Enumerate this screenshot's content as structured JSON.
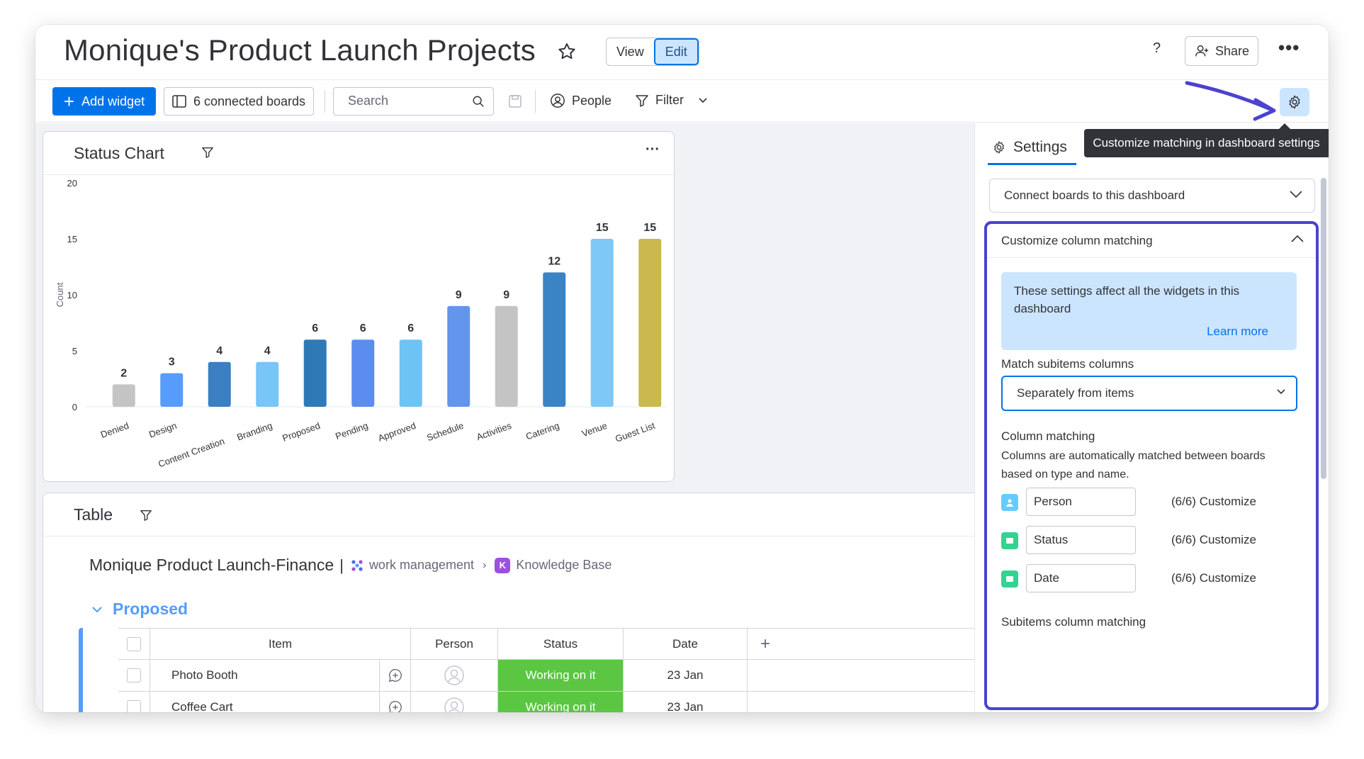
{
  "header": {
    "title": "Monique's Product Launch Projects",
    "view_label": "View",
    "edit_label": "Edit",
    "help_label": "?",
    "share_label": "Share"
  },
  "toolbar": {
    "add_widget_label": "Add widget",
    "boards_label": "6 connected boards",
    "search_placeholder": "Search",
    "people_label": "People",
    "filter_label": "Filter",
    "tooltip": "Customize matching in dashboard settings"
  },
  "chart_widget": {
    "title": "Status Chart"
  },
  "chart_data": {
    "type": "bar",
    "title": "Status Chart",
    "xlabel": "",
    "ylabel": "Count",
    "ylim": [
      0,
      20
    ],
    "yticks": [
      0,
      5,
      10,
      15,
      20
    ],
    "grid": false,
    "categories": [
      "Denied",
      "Design",
      "Content Creation",
      "Branding",
      "Proposed",
      "Pending",
      "Approved",
      "Schedule",
      "Activities",
      "Catering",
      "Venue",
      "Guest List"
    ],
    "values": [
      2,
      3,
      4,
      4,
      6,
      6,
      6,
      9,
      9,
      12,
      15,
      15
    ],
    "colors": [
      "#c4c4c4",
      "#579bfc",
      "#3a7fc1",
      "#78c5f7",
      "#2f79b7",
      "#5b8def",
      "#6ec3f5",
      "#6495ed",
      "#c4c4c4",
      "#3a84c5",
      "#7ec8f7",
      "#c9b94e"
    ]
  },
  "table_widget": {
    "title": "Table",
    "board_name": "Monique Product Launch-Finance",
    "pipe": "|",
    "workspace": "work management",
    "crumb_sep": "›",
    "kb_letter": "K",
    "kb_name": "Knowledge Base",
    "group_name": "Proposed",
    "columns": {
      "item": "Item",
      "person": "Person",
      "status": "Status",
      "date": "Date",
      "add": "+"
    },
    "rows": [
      {
        "item": "Photo Booth",
        "status": "Working on it",
        "date": "23 Jan"
      },
      {
        "item": "Coffee Cart",
        "status": "Working on it",
        "date": "23 Jan"
      }
    ]
  },
  "settings": {
    "tab_label": "Settings",
    "connect_label": "Connect boards to this dashboard",
    "matching_label": "Customize column matching",
    "info_text": "These settings affect all the widgets in this dashboard",
    "learn_more": "Learn more",
    "subitems_label": "Match subitems columns",
    "subitems_value": "Separately from items",
    "column_matching_label": "Column matching",
    "column_matching_desc": "Columns are automatically matched between boards based on type and name.",
    "matches": [
      {
        "name": "Person",
        "count": "(6/6)",
        "action": "Customize",
        "icon_color": "#66ccff"
      },
      {
        "name": "Status",
        "count": "(6/6)",
        "action": "Customize",
        "icon_color": "#33d391"
      },
      {
        "name": "Date",
        "count": "(6/6)",
        "action": "Customize",
        "icon_color": "#33d391"
      }
    ],
    "subitems_matching_label": "Subitems column matching"
  },
  "colors": {
    "accent": "#0073ea",
    "highlight": "#4a43cf",
    "status_green": "#5ac641"
  }
}
